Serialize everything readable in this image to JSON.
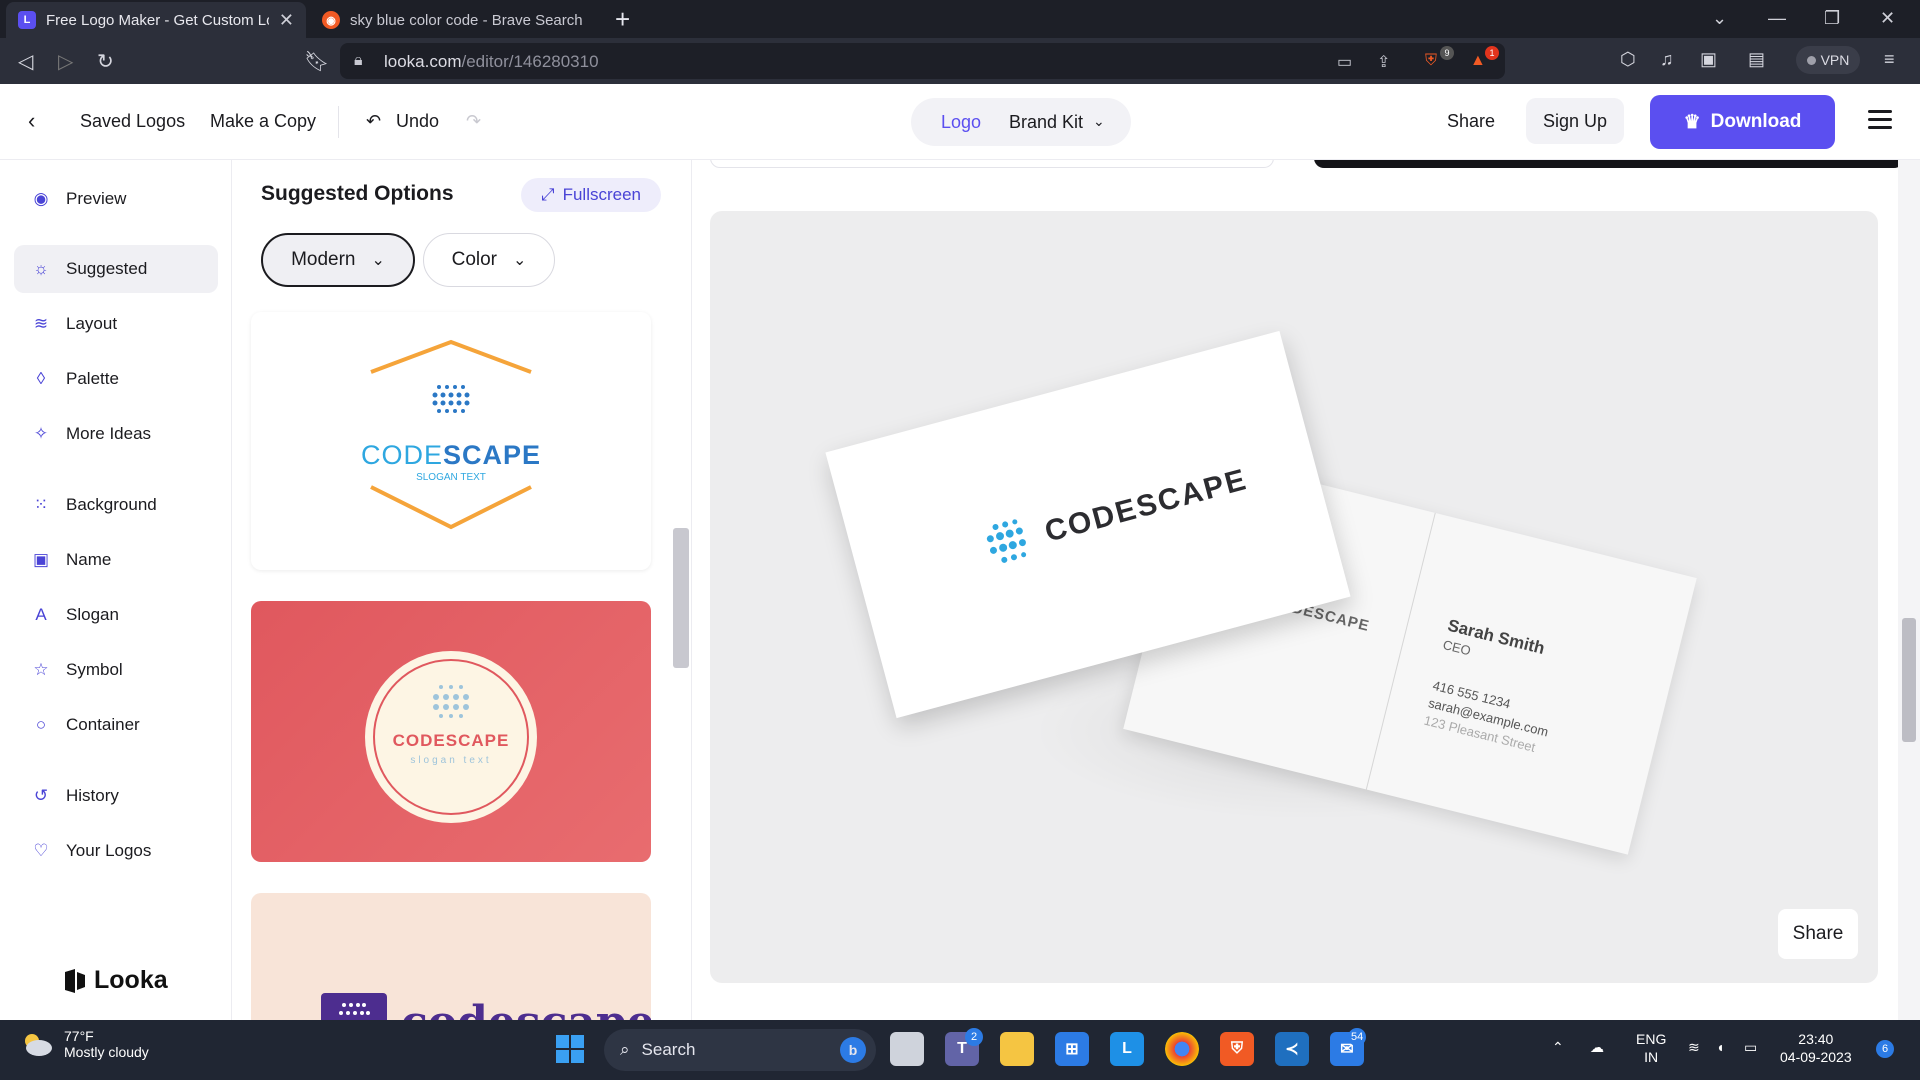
{
  "browser": {
    "tabs": [
      {
        "title": "Free Logo Maker - Get Custom Lo",
        "active": true
      },
      {
        "title": "sky blue color code - Brave Search",
        "active": false
      }
    ],
    "url_host": "looka.com",
    "url_path": "/editor/146280310",
    "shield_count": "9",
    "alert_count": "1",
    "vpn_label": "VPN"
  },
  "header": {
    "saved_logos": "Saved Logos",
    "make_copy": "Make a Copy",
    "undo": "Undo",
    "seg_logo": "Logo",
    "seg_brand_kit": "Brand Kit",
    "share": "Share",
    "sign_up": "Sign Up",
    "download": "Download"
  },
  "nav": {
    "items": [
      {
        "label": "Preview",
        "icon": "eye-icon"
      },
      {
        "label": "Suggested",
        "icon": "lightbulb-icon"
      },
      {
        "label": "Layout",
        "icon": "layers-icon"
      },
      {
        "label": "Palette",
        "icon": "droplet-icon"
      },
      {
        "label": "More Ideas",
        "icon": "magic-wand-icon"
      },
      {
        "label": "Background",
        "icon": "grid-dots-icon"
      },
      {
        "label": "Name",
        "icon": "text-box-icon"
      },
      {
        "label": "Slogan",
        "icon": "font-icon"
      },
      {
        "label": "Symbol",
        "icon": "star-icon"
      },
      {
        "label": "Container",
        "icon": "circle-icon"
      },
      {
        "label": "History",
        "icon": "history-icon"
      },
      {
        "label": "Your Logos",
        "icon": "heart-icon"
      }
    ],
    "brand": "Looka"
  },
  "panel": {
    "title": "Suggested Options",
    "fullscreen": "Fullscreen",
    "style_select": "Modern",
    "color_select": "Color",
    "cards": [
      {
        "name_light": "CODE",
        "name_bold": "SCAPE",
        "slogan": "SLOGAN TEXT"
      },
      {
        "name": "CODESCAPE",
        "slogan": "slogan text"
      },
      {
        "name": "codescape"
      }
    ]
  },
  "mockup": {
    "front_logo": "CODESCAPE",
    "back_logo": "CODESCAPE",
    "person_name": "Sarah Smith",
    "person_title": "CEO",
    "phone": "416 555 1234",
    "email": "sarah@example.com",
    "address": "123 Pleasant Street",
    "share": "Share"
  },
  "taskbar": {
    "temp": "77°F",
    "condition": "Mostly cloudy",
    "search": "Search",
    "lang1": "ENG",
    "lang2": "IN",
    "time": "23:40",
    "date": "04-09-2023",
    "teams_badge": "2",
    "mail_badge": "54",
    "notif_count": "6"
  },
  "colors": {
    "accent": "#5b4ff0",
    "sky_blue": "#2ea7e0",
    "orange": "#f5a43a",
    "red_card": "#e0585e",
    "peach_card": "#f8e4d8"
  }
}
